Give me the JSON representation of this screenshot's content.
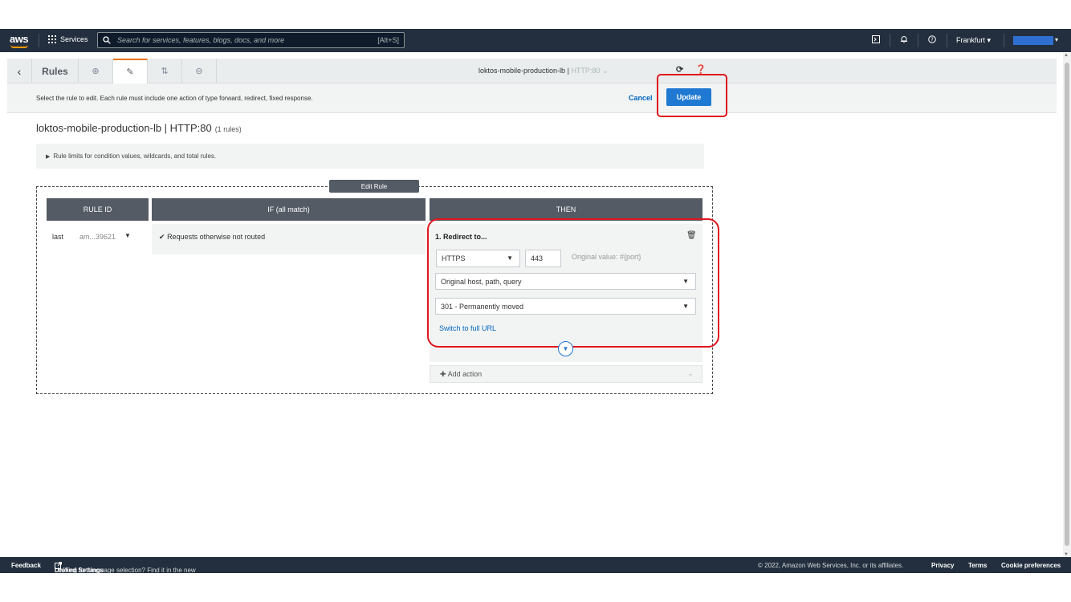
{
  "topbar": {
    "logo": "aws",
    "services": "Services",
    "search_placeholder": "Search for services, features, blogs, docs, and more",
    "search_shortcut": "[Alt+S]",
    "region": "Frankfurt"
  },
  "toolbar": {
    "rules_label": "Rules",
    "lb_name": "loktos-mobile-production-lb",
    "sep": "|",
    "listener": "HTTP:80"
  },
  "infobar": {
    "message": "Select the rule to edit. Each rule must include one action of type forward, redirect, fixed response.",
    "cancel": "Cancel",
    "update": "Update"
  },
  "main": {
    "title": "loktos-mobile-production-lb | HTTP:80",
    "rule_count": "(1 rules)",
    "limits": "Rule limits for condition values, wildcards, and total rules.",
    "edit_rule": "Edit Rule"
  },
  "table": {
    "headers": [
      "RULE ID",
      "IF (all match)",
      "THEN"
    ],
    "rule_name": "last",
    "rule_id": "am...39621",
    "condition": "Requests otherwise not routed"
  },
  "action": {
    "title": "1. Redirect to...",
    "protocol": "HTTPS",
    "port": "443",
    "original_value": "Original value: #{port}",
    "host_path": "Original host, path, query",
    "status": "301 - Permanently moved",
    "switch_link": "Switch to full URL",
    "add_action": "Add action"
  },
  "footer": {
    "feedback": "Feedback",
    "lang_text": "Looking for language selection? Find it in the new",
    "unified": "Unified Settings",
    "copyright": "© 2022, Amazon Web Services, Inc. or its affiliates.",
    "privacy": "Privacy",
    "terms": "Terms",
    "cookies": "Cookie preferences"
  },
  "colors": {
    "aws_nav": "#232f3e",
    "accent_orange": "#ec7211",
    "primary_blue": "#1f78d1",
    "highlight_red": "#e0151d"
  }
}
